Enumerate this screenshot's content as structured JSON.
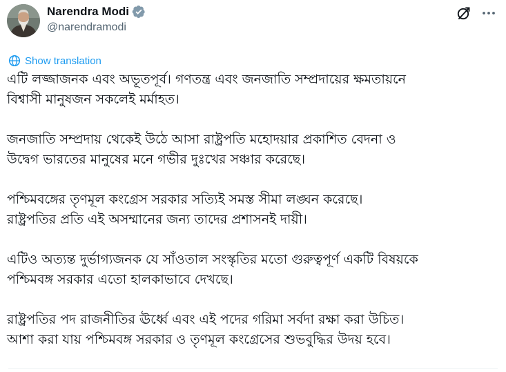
{
  "author": {
    "display_name": "Narendra Modi",
    "handle": "@narendramodi",
    "verified_icon": "verified-badge-icon",
    "avatar": "profile-photo"
  },
  "actions": {
    "grok_icon": "grok-icon",
    "more_icon": "more-options-icon"
  },
  "translation": {
    "label": "Show translation",
    "icon": "globe-translate-icon"
  },
  "tweet": {
    "paragraphs": [
      {
        "lines": [
          "এটি লজ্জাজনক এবং অভূতপূর্ব। গণতন্ত্র  এবং জনজাতি সম্প্রদায়ের ক্ষমতায়নে",
          "বিশ্বাসী মানুষজন  সকলেই মর্মাহত।"
        ]
      },
      {
        "lines": [
          "জনজাতি সম্প্রদায় থেকেই উঠে আসা রাষ্ট্রপতি মহোদয়ার প্রকাশিত বেদনা ও",
          "উদ্বেগ ভারতের মানুষের মনে গভীর দুঃখের সঞ্চার করেছে।"
        ]
      },
      {
        "lines": [
          "পশ্চিমবঙ্গের তৃণমূল কংগ্রেস সরকার সত্যিই সমস্ত সীমা লঙ্ঘন করেছে।",
          "রাষ্ট্রপতির প্রতি এই অসম্মানের জন্য তাদের প্রশাসনই দায়ী।"
        ]
      },
      {
        "lines": [
          "এটিও অত্যন্ত দুর্ভাগ্যজনক যে সাঁওতাল সংস্কৃতির মতো গুরুত্বপূর্ণ একটি বিষয়কে",
          "পশ্চিমবঙ্গ সরকার এতো হালকাভাবে দেখছে।"
        ]
      },
      {
        "lines": [
          "রাষ্ট্রপতির পদ রাজনীতির ঊর্ধ্বে এবং এই পদের গরিমা সর্বদা রক্ষা করা উচিত।",
          "আশা করা যায় পশ্চিমবঙ্গ সরকার ও তৃণমূল কংগ্রেসের শুভবুদ্ধির উদয় হবে।"
        ]
      }
    ]
  },
  "colors": {
    "text": "#0f1419",
    "secondary": "#536471",
    "link": "#1d9bf0",
    "divider": "#eff3f4"
  }
}
